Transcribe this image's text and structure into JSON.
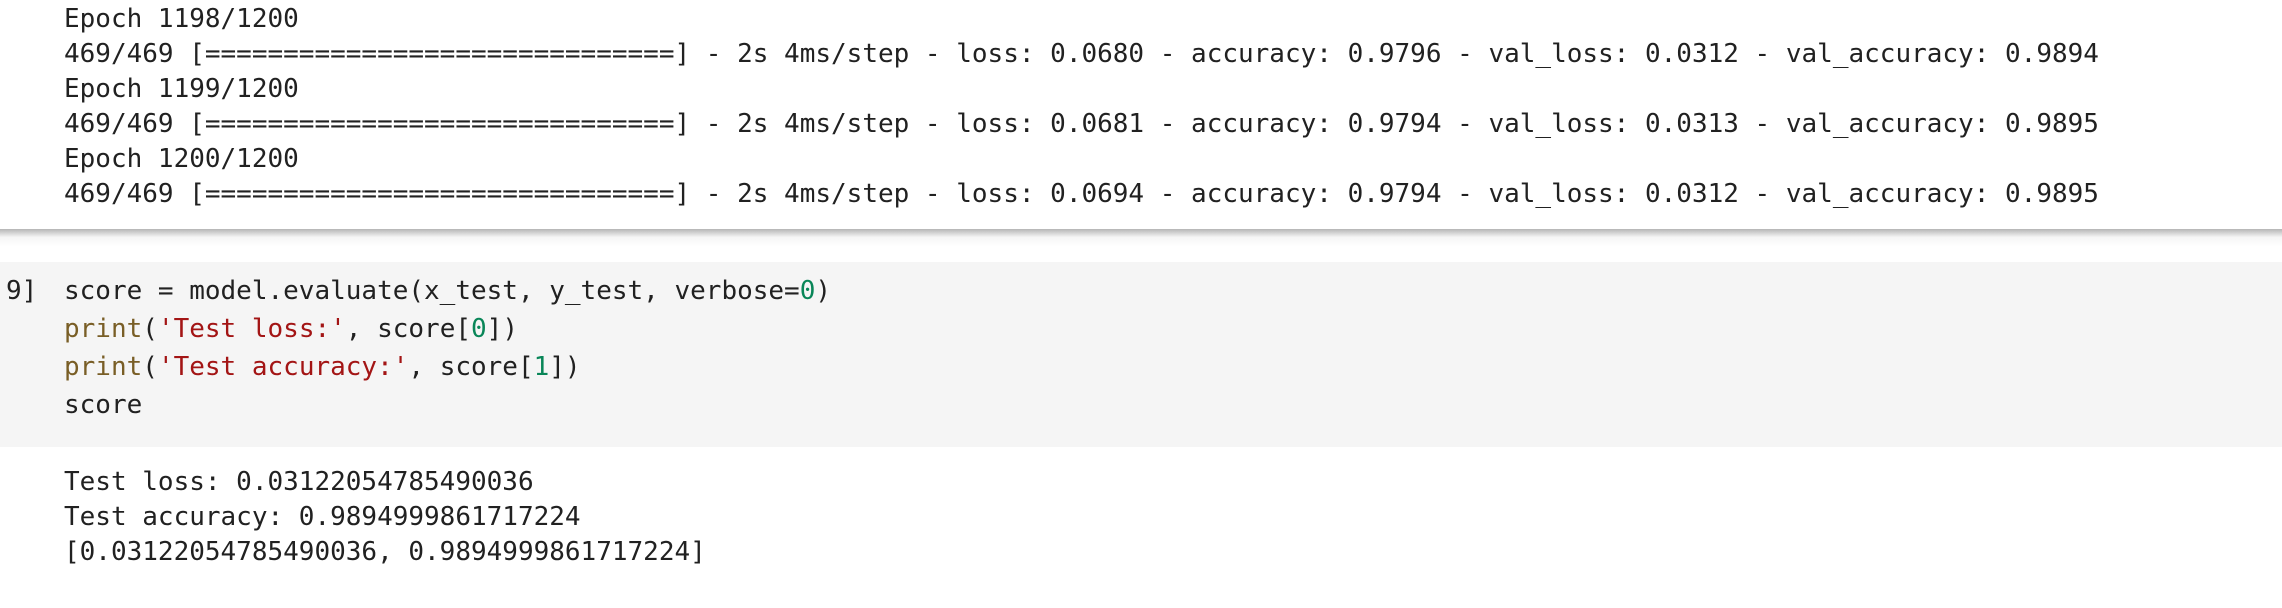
{
  "training_output": {
    "lines": [
      "Epoch 1198/1200",
      "469/469 [==============================] - 2s 4ms/step - loss: 0.0680 - accuracy: 0.9796 - val_loss: 0.0312 - val_accuracy: 0.9894",
      "Epoch 1199/1200",
      "469/469 [==============================] - 2s 4ms/step - loss: 0.0681 - accuracy: 0.9794 - val_loss: 0.0313 - val_accuracy: 0.9895",
      "Epoch 1200/1200",
      "469/469 [==============================] - 2s 4ms/step - loss: 0.0694 - accuracy: 0.9794 - val_loss: 0.0312 - val_accuracy: 0.9895"
    ]
  },
  "code_cell": {
    "execution_count": "9]",
    "line1": {
      "prefix": "score = model.evaluate(x_test, y_test, verbose=",
      "num": "0",
      "suffix": ")"
    },
    "line2": {
      "fn": "print",
      "open": "(",
      "str": "'Test loss:'",
      "mid": ", score[",
      "num": "0",
      "close": "])"
    },
    "line3": {
      "fn": "print",
      "open": "(",
      "str": "'Test accuracy:'",
      "mid": ", score[",
      "num": "1",
      "close": "])"
    },
    "line4": "score"
  },
  "cell_output": {
    "lines": [
      "Test loss: 0.03122054785490036",
      "Test accuracy: 0.9894999861717224",
      "[0.03122054785490036, 0.9894999861717224]"
    ]
  },
  "colors": {
    "function": "#795e26",
    "string": "#a31515",
    "number": "#098658",
    "code_cell_bg": "#f5f5f5"
  }
}
